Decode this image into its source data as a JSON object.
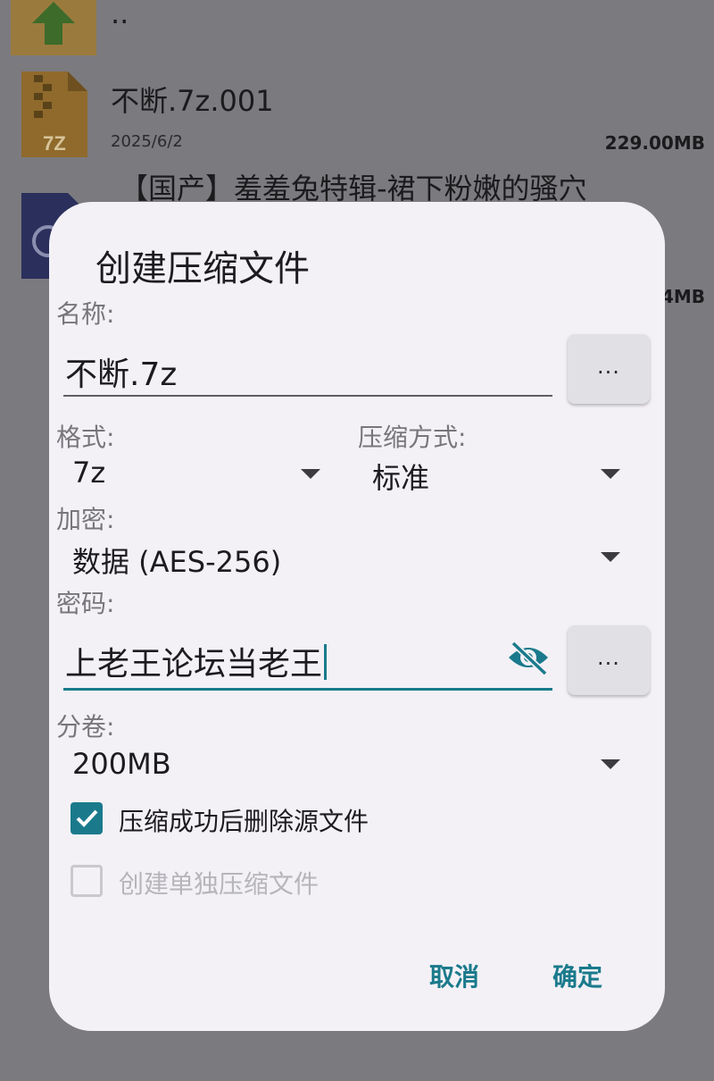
{
  "background": {
    "files": [
      {
        "name": "..",
        "date": "",
        "size": "",
        "icon": "folder-up-icon"
      },
      {
        "name": "不断.7z.001",
        "date": "2025/6/2",
        "size": "229.00MB",
        "icon": "7z-archive-icon",
        "icon_text": "7Z"
      },
      {
        "name": "【国产】羞羞兔特辑-裙下粉嫩的骚穴",
        "date": "",
        "size": "4MB",
        "icon": "video-file-icon"
      }
    ]
  },
  "dialog": {
    "title": "创建压缩文件",
    "name_label": "名称:",
    "name_value": "不断.7z",
    "browse_label": "...",
    "format_label": "格式:",
    "format_value": "7z",
    "method_label": "压缩方式:",
    "method_value": "标准",
    "encrypt_label": "加密:",
    "encrypt_value": "数据 (AES-256)",
    "password_label": "密码:",
    "password_value": "上老王论坛当老王",
    "password_more_label": "...",
    "split_label": "分卷:",
    "split_value": "200MB",
    "delete_source_label": "压缩成功后删除源文件",
    "delete_source_checked": true,
    "separate_label": "创建单独压缩文件",
    "separate_checked": false,
    "cancel_label": "取消",
    "ok_label": "确定"
  },
  "colors": {
    "accent": "#1a7a8c",
    "dialog_bg": "#f3f1f6",
    "scrim": "#7b7a7e"
  }
}
